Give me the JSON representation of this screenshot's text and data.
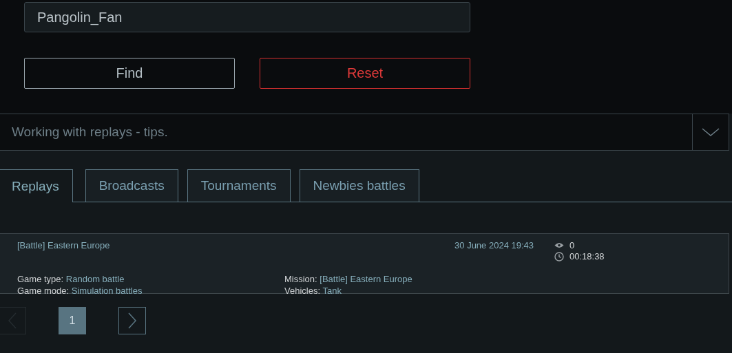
{
  "search": {
    "value": "Pangolin_Fan"
  },
  "buttons": [
    {
      "label": "Find",
      "kind": "primary"
    },
    {
      "label": "Reset",
      "kind": "danger"
    }
  ],
  "tips": {
    "title": "Working with replays - tips.",
    "expanded": false
  },
  "tabs": [
    {
      "label": "Replays",
      "selected": true
    },
    {
      "label": "Broadcasts",
      "selected": false
    },
    {
      "label": "Tournaments",
      "selected": false
    },
    {
      "label": "Newbies battles",
      "selected": false
    }
  ],
  "replays": [
    {
      "title": "[Battle] Eastern Europe",
      "date": "30 June 2024 19:43",
      "views": "0",
      "duration": "00:18:38",
      "fields": [
        {
          "label": "Game type:",
          "value": "Random battle"
        },
        {
          "label": "Mission:",
          "value": "[Battle] Eastern Europe"
        },
        {
          "label": "Game mode:",
          "value": "Simulation battles"
        },
        {
          "label": "Vehicles:",
          "value": "Tank"
        }
      ]
    }
  ],
  "pagination": {
    "prev_disabled": true,
    "pages": [
      {
        "label": "1",
        "selected": true
      }
    ]
  }
}
